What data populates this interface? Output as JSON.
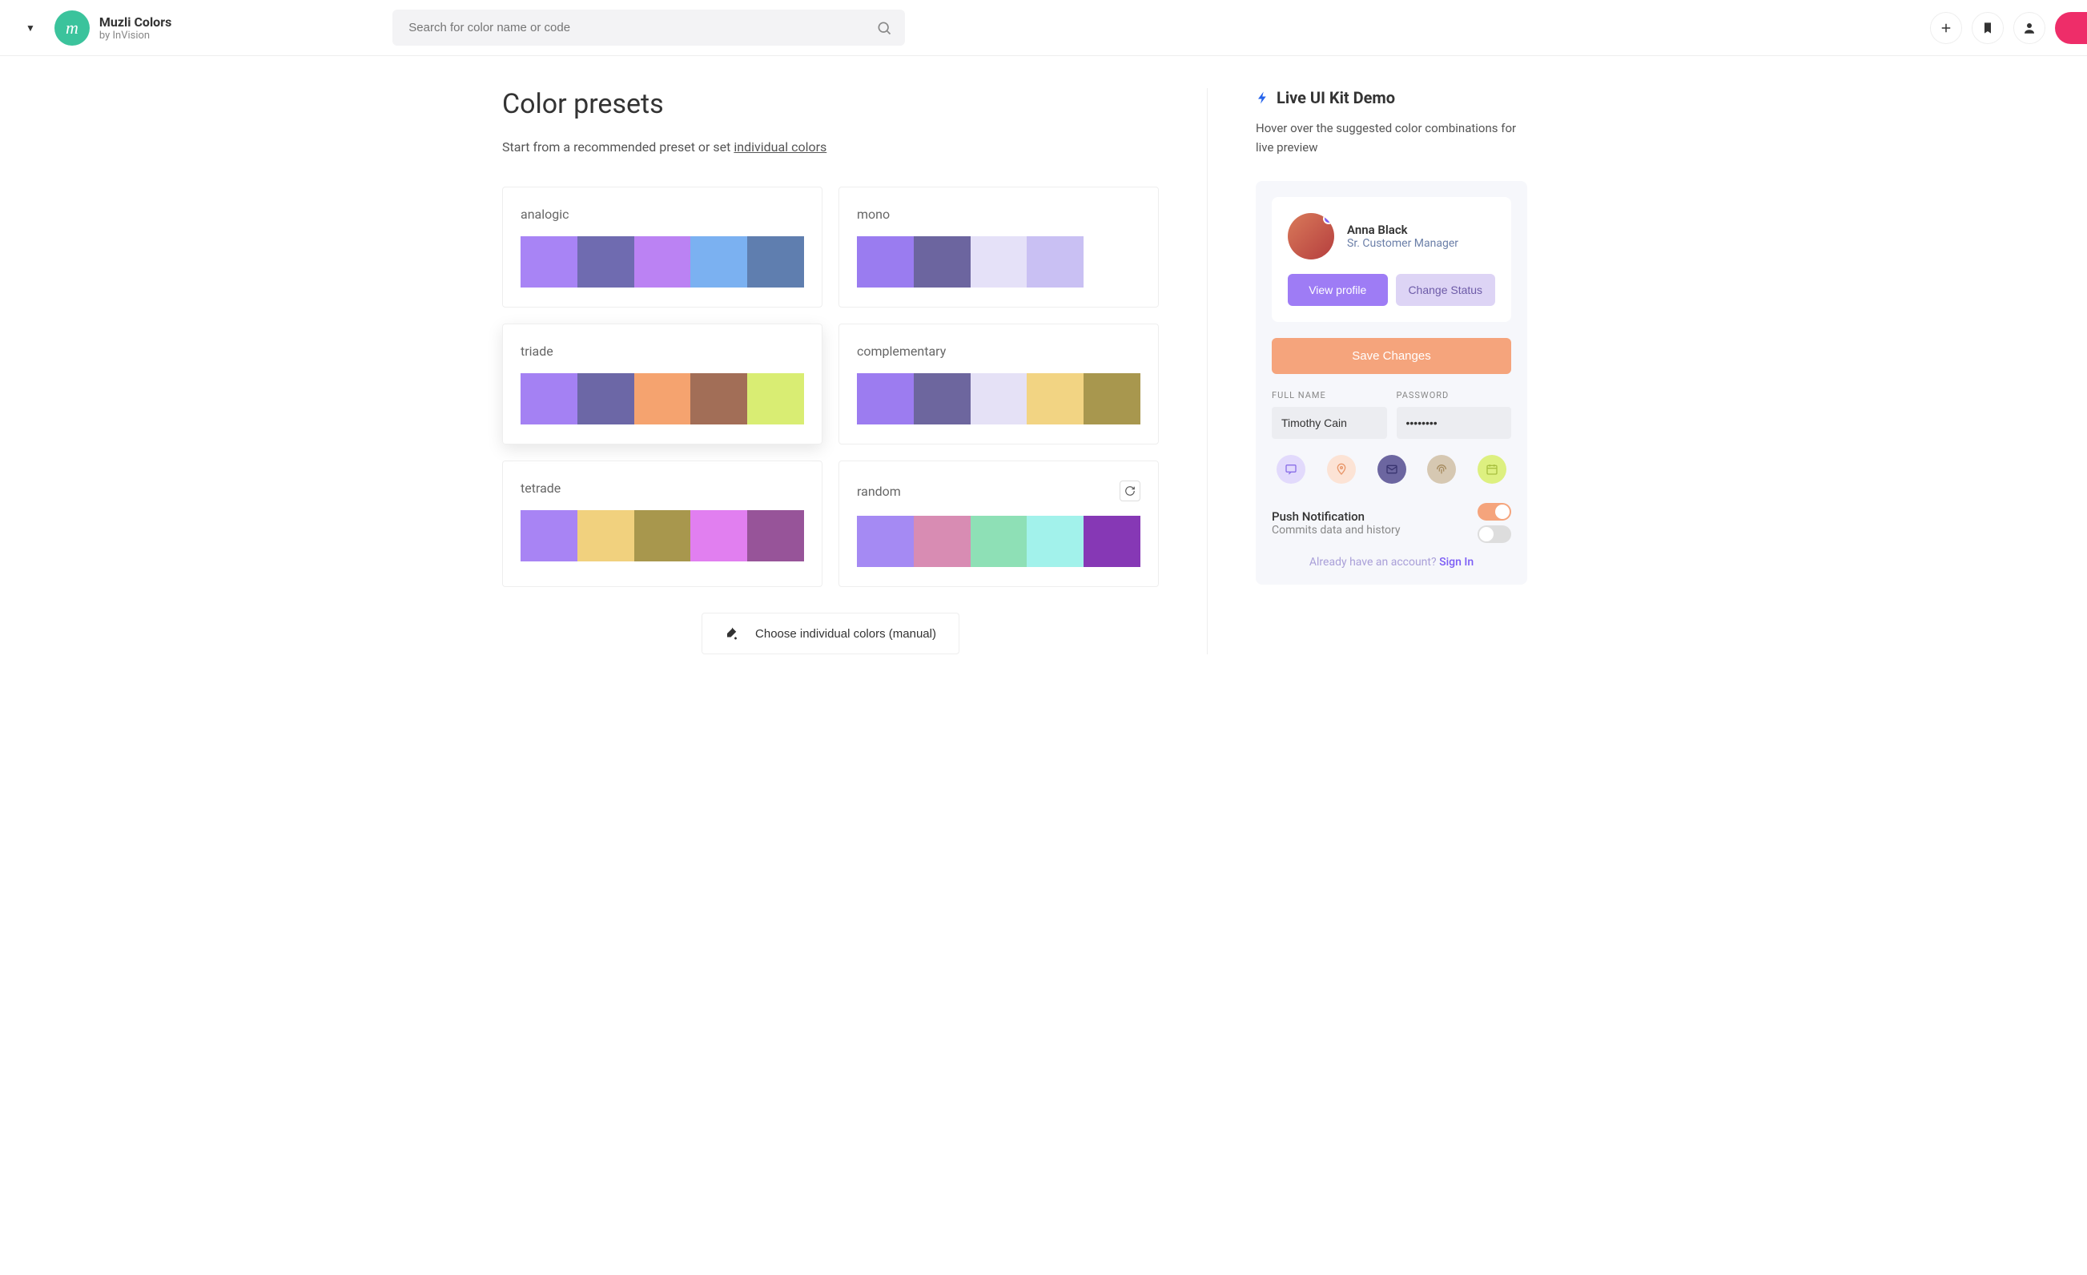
{
  "header": {
    "brand_title": "Muzli Colors",
    "brand_sub": "by InVision",
    "search_placeholder": "Search for color name or code"
  },
  "page": {
    "title": "Color presets",
    "subtitle_prefix": "Start from a recommended preset or set ",
    "subtitle_link": "individual colors",
    "manual_button": "Choose individual colors (manual)"
  },
  "presets": [
    {
      "name": "analogic",
      "colors": [
        "#a884f5",
        "#6f6bb0",
        "#bb82f3",
        "#7bb1f1",
        "#5f7eaf"
      ],
      "active": false,
      "refresh": false
    },
    {
      "name": "mono",
      "colors": [
        "#9a7cf0",
        "#6c659f",
        "#e5e1f8",
        "#c9c0f3",
        "#ffffff"
      ],
      "active": false,
      "refresh": false
    },
    {
      "name": "triade",
      "colors": [
        "#a481f3",
        "#6c67a6",
        "#f5a36f",
        "#a26e57",
        "#d9ed73"
      ],
      "active": true,
      "refresh": false
    },
    {
      "name": "complementary",
      "colors": [
        "#9c7cf0",
        "#6d669e",
        "#e5e1f6",
        "#f2d483",
        "#a8974e"
      ],
      "active": false,
      "refresh": false
    },
    {
      "name": "tetrade",
      "colors": [
        "#a884f4",
        "#f1d17e",
        "#a8974d",
        "#e17ff0",
        "#975499"
      ],
      "active": false,
      "refresh": false
    },
    {
      "name": "random",
      "colors": [
        "#a58af3",
        "#d88cb3",
        "#8ee0b6",
        "#a2f2eb",
        "#8638b5"
      ],
      "active": false,
      "refresh": true
    }
  ],
  "demo": {
    "title": "Live UI Kit Demo",
    "subtitle": "Hover over the suggested color combinations for live preview",
    "profile": {
      "name": "Anna Black",
      "role": "Sr. Customer Manager",
      "view_btn": "View profile",
      "status_btn": "Change Status"
    },
    "save_btn": "Save Changes",
    "form": {
      "fullname_label": "FULL NAME",
      "fullname_value": "Timothy Cain",
      "password_label": "PASSWORD",
      "password_value": "••••••••"
    },
    "icon_circles": [
      {
        "bg": "#e2dafc",
        "color": "#8a6fe8",
        "name": "chat-icon"
      },
      {
        "bg": "#fce3d5",
        "color": "#e89568",
        "name": "location-icon"
      },
      {
        "bg": "#6c66a0",
        "color": "#3a3570",
        "name": "mail-icon"
      },
      {
        "bg": "#d6c8b2",
        "color": "#a68b5f",
        "name": "fingerprint-icon"
      },
      {
        "bg": "#ddf080",
        "color": "#a8c040",
        "name": "calendar-icon"
      }
    ],
    "push_label": "Push Notification",
    "push_sub": "Commits data and history",
    "signin_prefix": "Already have an account? ",
    "signin_link": "Sign In"
  }
}
